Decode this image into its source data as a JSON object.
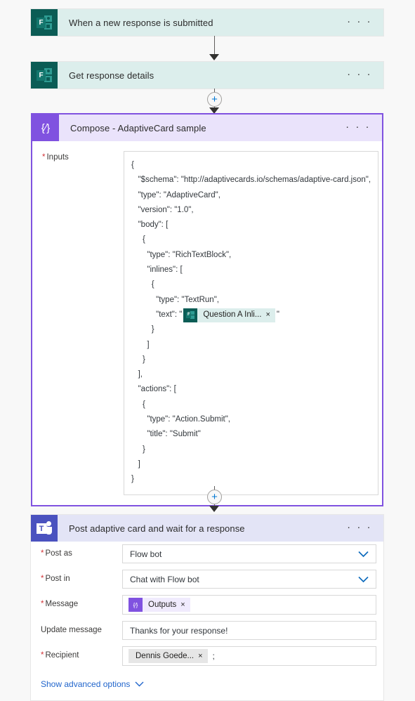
{
  "flow": {
    "trigger": {
      "title": "When a new response is submitted",
      "icon": "microsoft-forms-icon",
      "icon_letter": "F",
      "menu": "· · ·",
      "header_color": "#dceeec",
      "icon_color": "#0b5c55"
    },
    "get_response": {
      "title": "Get response details",
      "icon": "microsoft-forms-icon",
      "icon_letter": "F",
      "menu": "· · ·",
      "header_color": "#dceeec",
      "icon_color": "#0b5c55"
    },
    "compose": {
      "title": "Compose - AdaptiveCard sample",
      "icon": "compose-braces-icon",
      "icon_glyph": "{∕}",
      "menu": "· · ·",
      "header_color": "#eae3fb",
      "border_color": "#8052e0",
      "icon_color": "#8052e0",
      "inputs_label": "Inputs",
      "inputs_required": "*",
      "json_lines": [
        {
          "text": "{"
        },
        {
          "text": "   \"$schema\": \"http://adaptivecards.io/schemas/adaptive-card.json\","
        },
        {
          "text": "   \"type\": \"AdaptiveCard\","
        },
        {
          "text": "   \"version\": \"1.0\","
        },
        {
          "text": "   \"body\": ["
        },
        {
          "text": "     {"
        },
        {
          "text": "       \"type\": \"RichTextBlock\","
        },
        {
          "text": "       \"inlines\": ["
        },
        {
          "text": "         {"
        },
        {
          "text": "           \"type\": \"TextRun\","
        },
        {
          "prefix": "           \"text\": \"",
          "chip": "Question A Inli...",
          "chip_icon": "microsoft-forms-icon",
          "chip_letter": "F",
          "chip_close": "×",
          "suffix": "\""
        },
        {
          "text": "         }"
        },
        {
          "text": "       ]"
        },
        {
          "text": "     }"
        },
        {
          "text": "   ],"
        },
        {
          "text": "   \"actions\": ["
        },
        {
          "text": "     {"
        },
        {
          "text": "       \"type\": \"Action.Submit\","
        },
        {
          "text": "       \"title\": \"Submit\""
        },
        {
          "text": "     }"
        },
        {
          "text": "   ]"
        },
        {
          "text": "}"
        }
      ]
    },
    "post_card": {
      "title": "Post adaptive card and wait for a response",
      "icon": "microsoft-teams-icon",
      "icon_letter": "T",
      "menu": "· · ·",
      "header_color": "#e3e4f6",
      "icon_color": "#4a52bf",
      "fields": [
        {
          "label": "Post as",
          "required": true,
          "type": "dropdown",
          "value": "Flow bot"
        },
        {
          "label": "Post in",
          "required": true,
          "type": "dropdown",
          "value": "Chat with Flow bot"
        },
        {
          "label": "Message",
          "required": true,
          "type": "token",
          "chip": "Outputs",
          "chip_icon": "compose-braces-icon",
          "chip_glyph": "{∕}",
          "chip_close": "×"
        },
        {
          "label": "Update message",
          "required": false,
          "type": "text",
          "value": "Thanks for your response!"
        },
        {
          "label": "Recipient",
          "required": true,
          "type": "person",
          "chip": "Dennis Goede...",
          "chip_close": "×",
          "separator": ";"
        }
      ],
      "advanced_link": "Show advanced options"
    },
    "connectors": {
      "add_step_symbol": "+",
      "arrow_color": "#323130",
      "plus_color": "#0078d4"
    }
  }
}
